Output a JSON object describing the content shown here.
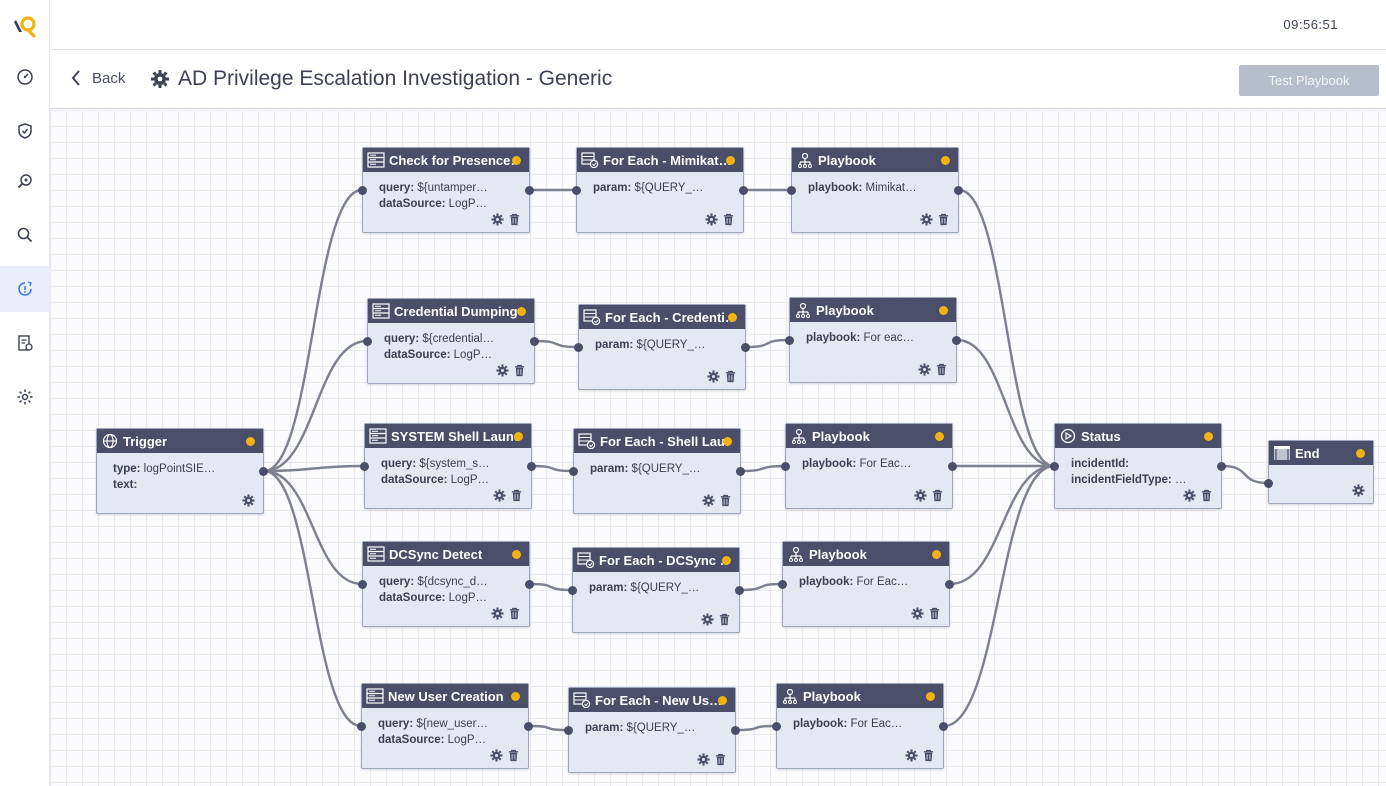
{
  "header": {
    "back_label": "Back",
    "title": "AD Privilege Escalation Investigation - Generic",
    "test_button": "Test Playbook"
  },
  "topbar": {
    "clock": "09:56:51"
  },
  "sidebar": {
    "items": [
      "dashboard-icon",
      "shield-check-icon",
      "search-zoom-icon",
      "search-icon",
      "playbook-alert-icon",
      "report-icon",
      "settings-icon"
    ],
    "active": 4
  },
  "colors": {
    "node_header": "#4a4e69",
    "node_body": "#e4e8f3",
    "status_dot": "#f2b311",
    "button": "#b6bdcc",
    "edge": "#7d818f"
  },
  "nodes": [
    {
      "id": "trigger",
      "title": "Trigger",
      "icon": "globe-icon",
      "fields": [
        [
          "type:",
          " logPointSIE…"
        ],
        [
          "text:",
          ""
        ]
      ],
      "delete": false
    },
    {
      "id": "q1",
      "title": "Check for Presence…",
      "icon": "server-icon",
      "fields": [
        [
          "query:",
          " ${untamper…"
        ],
        [
          "dataSource:",
          " LogP…"
        ]
      ],
      "delete": true
    },
    {
      "id": "f1",
      "title": "For Each - Mimikat…",
      "icon": "foreach-icon",
      "fields": [
        [
          "param:",
          " ${QUERY_…"
        ]
      ],
      "delete": true
    },
    {
      "id": "p1",
      "title": "Playbook",
      "icon": "playbook-icon",
      "fields": [
        [
          "playbook:",
          " Mimikat…"
        ]
      ],
      "delete": true
    },
    {
      "id": "q2",
      "title": "Credential Dumping",
      "icon": "server-icon",
      "fields": [
        [
          "query:",
          " ${credential…"
        ],
        [
          "dataSource:",
          " LogP…"
        ]
      ],
      "delete": true
    },
    {
      "id": "f2",
      "title": "For Each - Credenti…",
      "icon": "foreach-icon",
      "fields": [
        [
          "param:",
          " ${QUERY_…"
        ]
      ],
      "delete": true
    },
    {
      "id": "p2",
      "title": "Playbook",
      "icon": "playbook-icon",
      "fields": [
        [
          "playbook:",
          " For eac…"
        ]
      ],
      "delete": true
    },
    {
      "id": "q3",
      "title": "SYSTEM Shell Launch",
      "icon": "server-icon",
      "fields": [
        [
          "query:",
          " ${system_s…"
        ],
        [
          "dataSource:",
          " LogP…"
        ]
      ],
      "delete": true
    },
    {
      "id": "f3",
      "title": "For Each - Shell Lau…",
      "icon": "foreach-icon",
      "fields": [
        [
          "param:",
          " ${QUERY_…"
        ]
      ],
      "delete": true
    },
    {
      "id": "p3",
      "title": "Playbook",
      "icon": "playbook-icon",
      "fields": [
        [
          "playbook:",
          " For Eac…"
        ]
      ],
      "delete": true
    },
    {
      "id": "q4",
      "title": "DCSync Detect",
      "icon": "server-icon",
      "fields": [
        [
          "query:",
          " ${dcsync_d…"
        ],
        [
          "dataSource:",
          " LogP…"
        ]
      ],
      "delete": true
    },
    {
      "id": "f4",
      "title": "For Each - DCSync …",
      "icon": "foreach-icon",
      "fields": [
        [
          "param:",
          " ${QUERY_…"
        ]
      ],
      "delete": true
    },
    {
      "id": "p4",
      "title": "Playbook",
      "icon": "playbook-icon",
      "fields": [
        [
          "playbook:",
          " For Eac…"
        ]
      ],
      "delete": true
    },
    {
      "id": "q5",
      "title": "New User Creation",
      "icon": "server-icon",
      "fields": [
        [
          "query:",
          " ${new_user…"
        ],
        [
          "dataSource:",
          " LogP…"
        ]
      ],
      "delete": true
    },
    {
      "id": "f5",
      "title": "For Each - New Us…",
      "icon": "foreach-icon",
      "fields": [
        [
          "param:",
          " ${QUERY_…"
        ]
      ],
      "delete": true
    },
    {
      "id": "p5",
      "title": "Playbook",
      "icon": "playbook-icon",
      "fields": [
        [
          "playbook:",
          " For Eac…"
        ]
      ],
      "delete": true
    },
    {
      "id": "status",
      "title": "Status",
      "icon": "play-circle-icon",
      "fields": [
        [
          "incidentId:",
          ""
        ],
        [
          "incidentFieldType:",
          " …"
        ]
      ],
      "delete": true
    },
    {
      "id": "end",
      "title": "End",
      "icon": "end-icon",
      "fields": [],
      "delete": false
    }
  ],
  "edges": [
    [
      "trigger",
      "q1"
    ],
    [
      "trigger",
      "q2"
    ],
    [
      "trigger",
      "q3"
    ],
    [
      "trigger",
      "q4"
    ],
    [
      "trigger",
      "q5"
    ],
    [
      "q1",
      "f1"
    ],
    [
      "f1",
      "p1"
    ],
    [
      "p1",
      "status"
    ],
    [
      "q2",
      "f2"
    ],
    [
      "f2",
      "p2"
    ],
    [
      "p2",
      "status"
    ],
    [
      "q3",
      "f3"
    ],
    [
      "f3",
      "p3"
    ],
    [
      "p3",
      "status"
    ],
    [
      "q4",
      "f4"
    ],
    [
      "f4",
      "p4"
    ],
    [
      "p4",
      "status"
    ],
    [
      "q5",
      "f5"
    ],
    [
      "f5",
      "p5"
    ],
    [
      "p5",
      "status"
    ],
    [
      "status",
      "end"
    ]
  ]
}
